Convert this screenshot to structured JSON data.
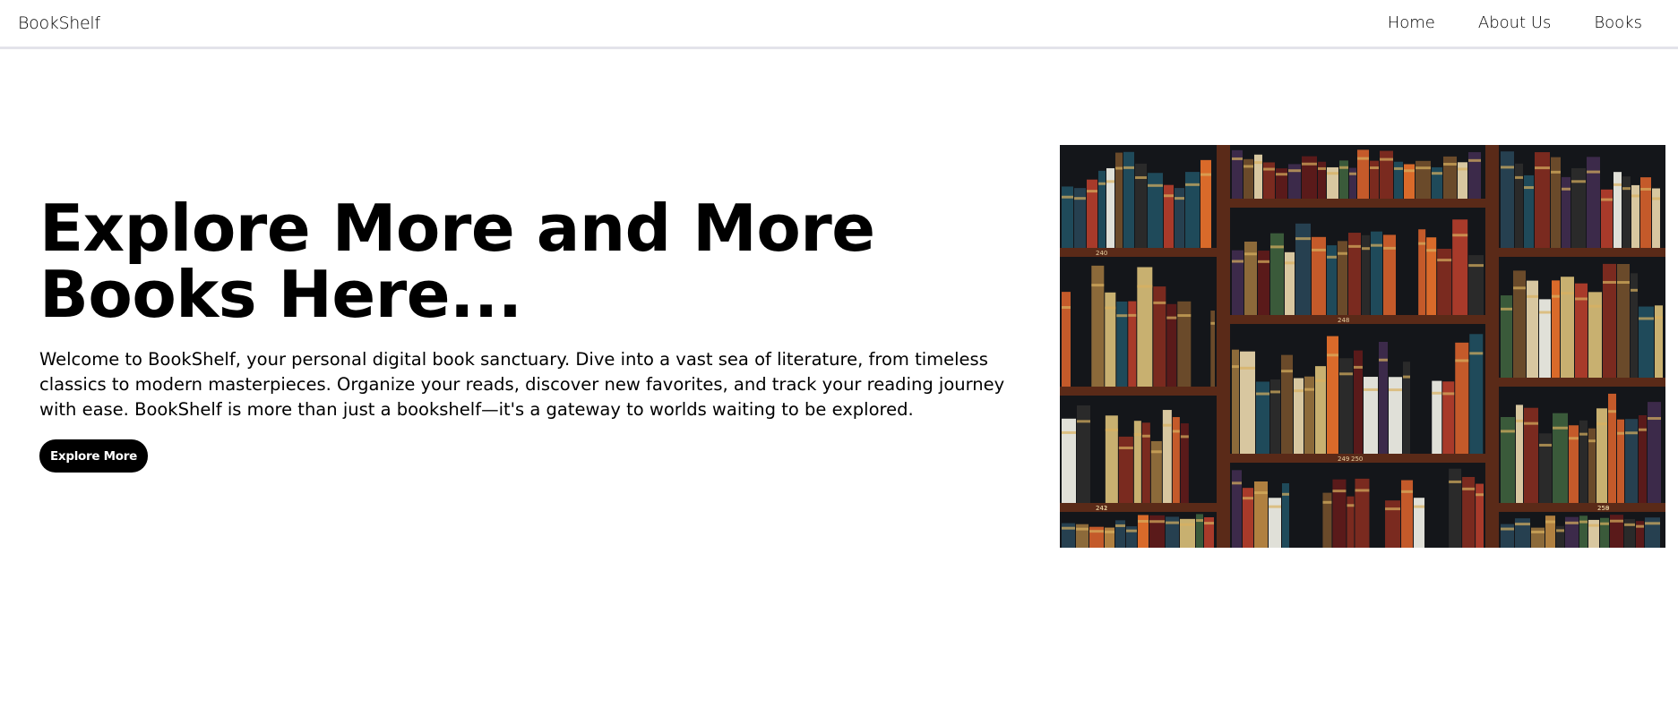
{
  "nav": {
    "brand": "BookShelf",
    "links": [
      "Home",
      "About Us",
      "Books"
    ]
  },
  "hero": {
    "title": "Explore More and More Books Here...",
    "description": "Welcome to BookShelf, your personal digital book sanctuary. Dive into a vast sea of literature, from timeless classics to modern masterpieces. Organize your reads, discover new favorites, and track your reading journey with ease. BookShelf is more than just a bookshelf—it's a gateway to worlds waiting to be explored.",
    "button_label": "Explore More",
    "image": {
      "alt": "bookshelf",
      "shelf_labels": [
        "240",
        "248",
        "259",
        "249",
        "241",
        "250",
        "242",
        "258"
      ]
    }
  },
  "colors": {
    "nav_border": "#e3e3ea",
    "button_bg": "#000000",
    "button_text": "#ffffff",
    "shelf_wood": "#5a2a18"
  }
}
